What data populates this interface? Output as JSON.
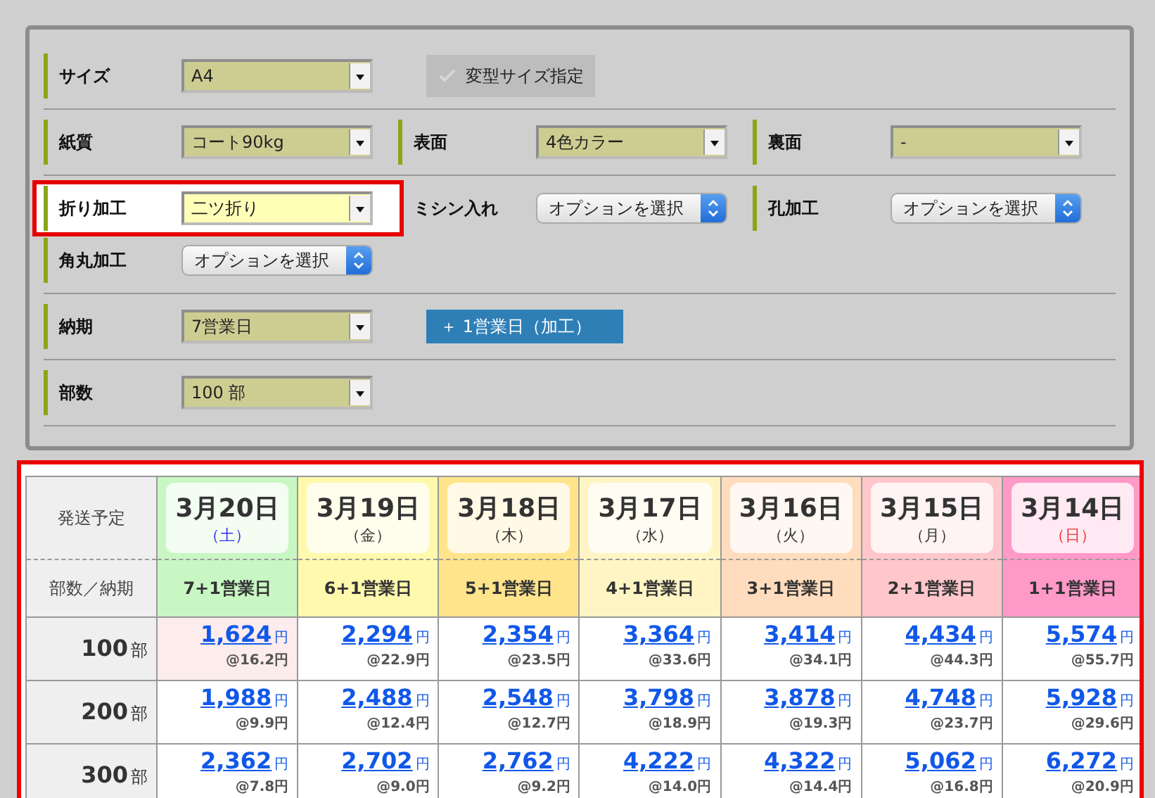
{
  "form": {
    "sections": [
      {
        "lines": [
          [
            {
              "kind": "select",
              "label": "サイズ",
              "value": "A4",
              "highlighted": false
            },
            {
              "kind": "checkbox",
              "label": "変型サイズ指定",
              "checked": false
            }
          ]
        ]
      },
      {
        "lines": [
          [
            {
              "kind": "select",
              "label": "紙質",
              "value": "コート90kg",
              "highlighted": false
            },
            {
              "kind": "select",
              "label": "表面",
              "value": "4色カラー",
              "highlighted": false
            },
            {
              "kind": "select",
              "label": "裏面",
              "value": "-",
              "highlighted": false
            }
          ]
        ]
      },
      {
        "lines": [
          [
            {
              "kind": "select",
              "label": "折り加工",
              "value": "二ツ折り",
              "highlighted": true
            },
            {
              "kind": "stepper",
              "label": "ミシン入れ",
              "value": "オプションを選択"
            },
            {
              "kind": "stepper",
              "label": "孔加工",
              "value": "オプションを選択"
            }
          ],
          [
            {
              "kind": "stepper",
              "label": "角丸加工",
              "value": "オプションを選択"
            }
          ]
        ]
      },
      {
        "lines": [
          [
            {
              "kind": "select",
              "label": "納期",
              "value": "7営業日",
              "highlighted": false
            },
            {
              "kind": "button",
              "label": "＋ 1営業日（加工）"
            }
          ]
        ]
      },
      {
        "lines": [
          [
            {
              "kind": "select",
              "label": "部数",
              "value": "100 部",
              "highlighted": false
            }
          ]
        ]
      }
    ]
  },
  "price_table": {
    "corner_top": "発送予定",
    "corner_bottom": "部数／納期",
    "columns": [
      {
        "date": "3月20日",
        "weekday": "（土）",
        "saturday": true,
        "sunday": false,
        "lead": "7+1営業日",
        "color": "#c9f7c4"
      },
      {
        "date": "3月19日",
        "weekday": "（金）",
        "saturday": false,
        "sunday": false,
        "lead": "6+1営業日",
        "color": "#fff9ad"
      },
      {
        "date": "3月18日",
        "weekday": "（木）",
        "saturday": false,
        "sunday": false,
        "lead": "5+1営業日",
        "color": "#ffe48c"
      },
      {
        "date": "3月17日",
        "weekday": "（水）",
        "saturday": false,
        "sunday": false,
        "lead": "4+1営業日",
        "color": "#fff5c4"
      },
      {
        "date": "3月16日",
        "weekday": "（火）",
        "saturday": false,
        "sunday": false,
        "lead": "3+1営業日",
        "color": "#ffdcbd"
      },
      {
        "date": "3月15日",
        "weekday": "（月）",
        "saturday": false,
        "sunday": false,
        "lead": "2+1営業日",
        "color": "#ffc7cb"
      },
      {
        "date": "3月14日",
        "weekday": "（日）",
        "saturday": false,
        "sunday": true,
        "lead": "1+1営業日",
        "color": "#ff99c8"
      }
    ],
    "rows": [
      {
        "quantity": "100",
        "unit": "部",
        "cells": [
          {
            "price": "1,624",
            "currency": "円",
            "unit_price": "@16.2円",
            "selected": true
          },
          {
            "price": "2,294",
            "currency": "円",
            "unit_price": "@22.9円",
            "selected": false
          },
          {
            "price": "2,354",
            "currency": "円",
            "unit_price": "@23.5円",
            "selected": false
          },
          {
            "price": "3,364",
            "currency": "円",
            "unit_price": "@33.6円",
            "selected": false
          },
          {
            "price": "3,414",
            "currency": "円",
            "unit_price": "@34.1円",
            "selected": false
          },
          {
            "price": "4,434",
            "currency": "円",
            "unit_price": "@44.3円",
            "selected": false
          },
          {
            "price": "5,574",
            "currency": "円",
            "unit_price": "@55.7円",
            "selected": false
          }
        ]
      },
      {
        "quantity": "200",
        "unit": "部",
        "cells": [
          {
            "price": "1,988",
            "currency": "円",
            "unit_price": "@9.9円",
            "selected": false
          },
          {
            "price": "2,488",
            "currency": "円",
            "unit_price": "@12.4円",
            "selected": false
          },
          {
            "price": "2,548",
            "currency": "円",
            "unit_price": "@12.7円",
            "selected": false
          },
          {
            "price": "3,798",
            "currency": "円",
            "unit_price": "@18.9円",
            "selected": false
          },
          {
            "price": "3,878",
            "currency": "円",
            "unit_price": "@19.3円",
            "selected": false
          },
          {
            "price": "4,748",
            "currency": "円",
            "unit_price": "@23.7円",
            "selected": false
          },
          {
            "price": "5,928",
            "currency": "円",
            "unit_price": "@29.6円",
            "selected": false
          }
        ]
      },
      {
        "quantity": "300",
        "unit": "部",
        "cells": [
          {
            "price": "2,362",
            "currency": "円",
            "unit_price": "@7.8円",
            "selected": false
          },
          {
            "price": "2,702",
            "currency": "円",
            "unit_price": "@9.0円",
            "selected": false
          },
          {
            "price": "2,762",
            "currency": "円",
            "unit_price": "@9.2円",
            "selected": false
          },
          {
            "price": "4,222",
            "currency": "円",
            "unit_price": "@14.0円",
            "selected": false
          },
          {
            "price": "4,322",
            "currency": "円",
            "unit_price": "@14.4円",
            "selected": false
          },
          {
            "price": "5,062",
            "currency": "円",
            "unit_price": "@16.8円",
            "selected": false
          },
          {
            "price": "6,272",
            "currency": "円",
            "unit_price": "@20.9円",
            "selected": false
          }
        ]
      }
    ]
  }
}
